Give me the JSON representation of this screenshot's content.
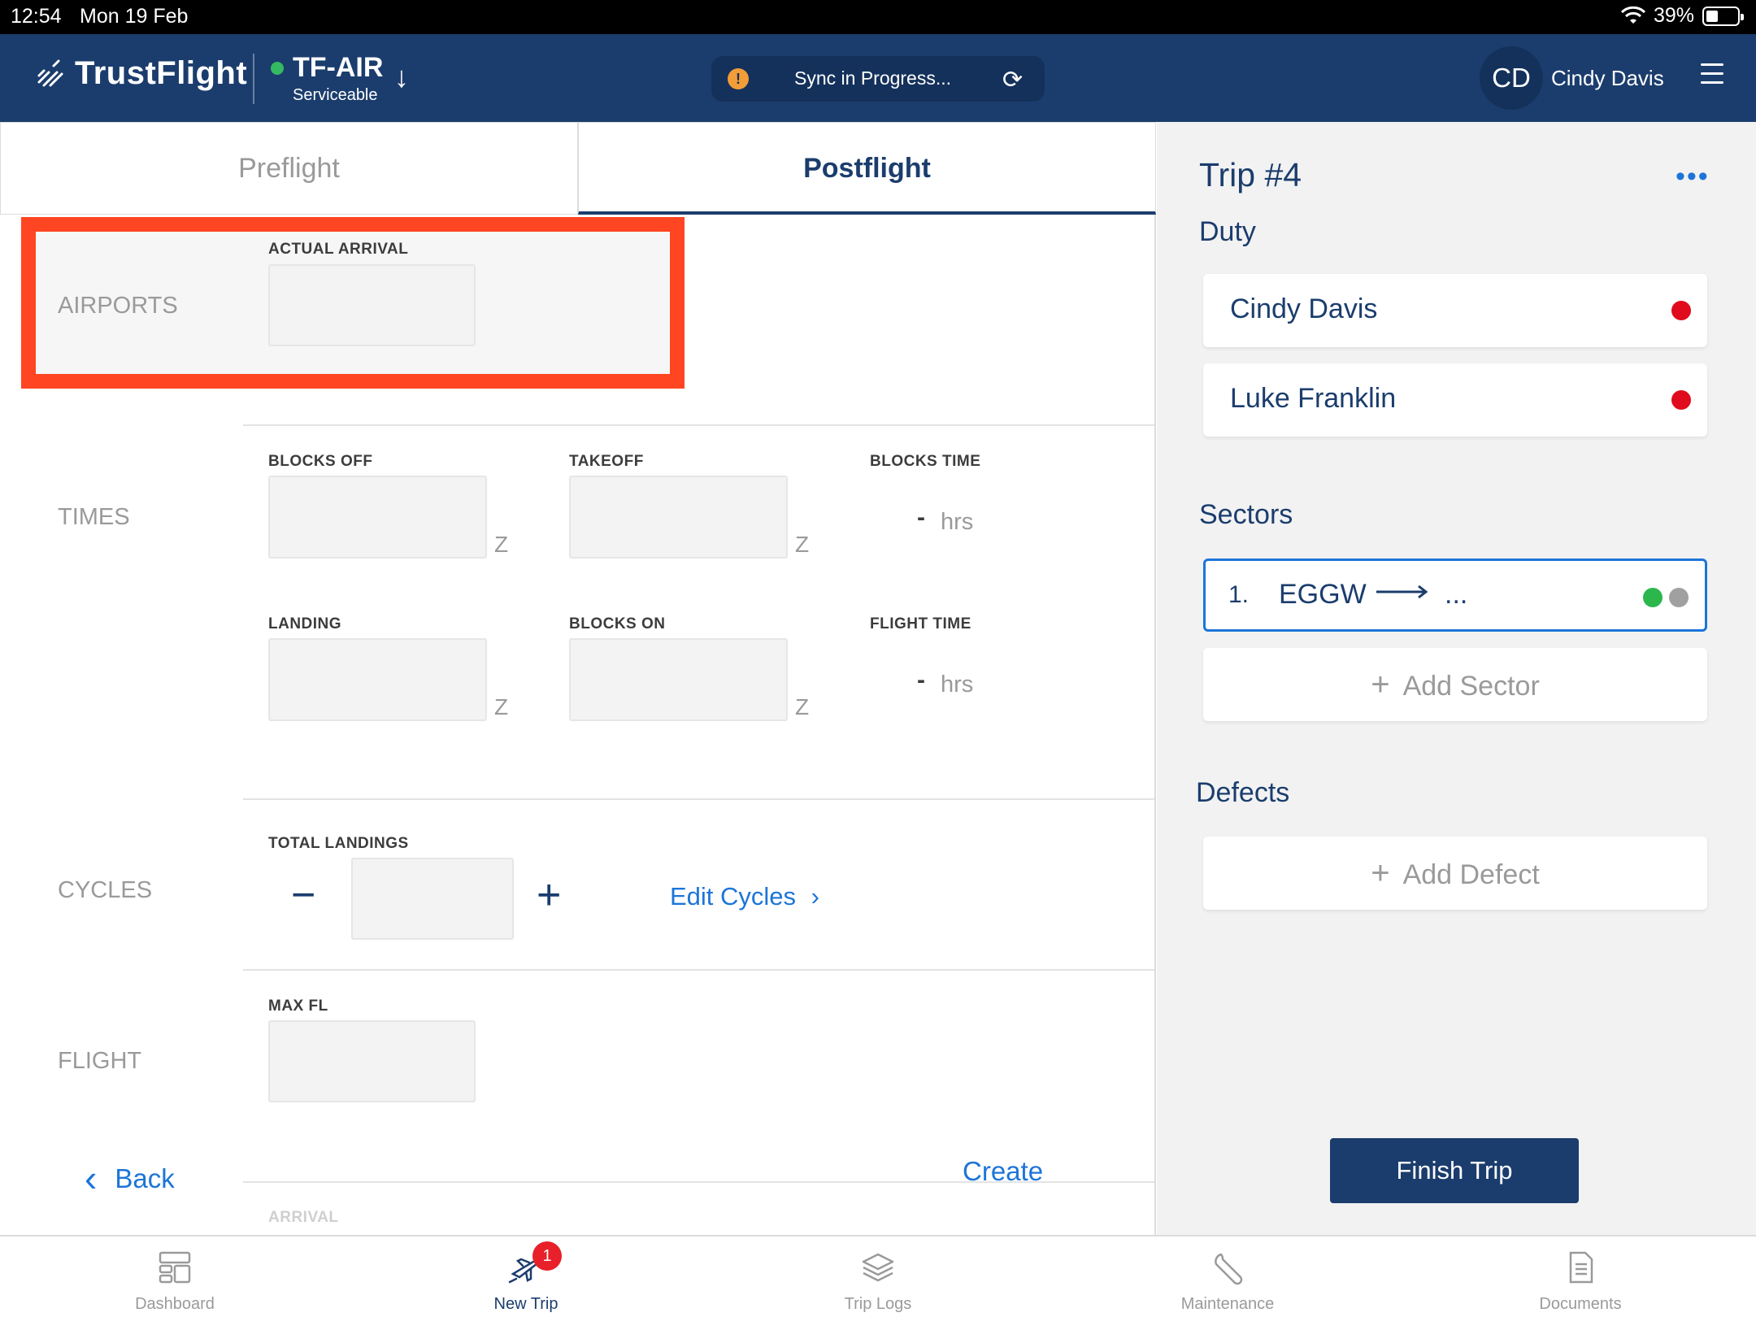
{
  "status_bar": {
    "time": "12:54",
    "date": "Mon 19 Feb",
    "battery": "39%"
  },
  "header": {
    "brand": "TrustFlight",
    "aircraft_reg": "TF-AIR",
    "aircraft_status": "Serviceable",
    "sync_text": "Sync in Progress...",
    "user_initials": "CD",
    "user_name": "Cindy Davis"
  },
  "tabs": [
    {
      "label": "Preflight",
      "active": false
    },
    {
      "label": "Postflight",
      "active": true
    }
  ],
  "form": {
    "airports": {
      "section": "AIRPORTS",
      "actual_arrival_label": "ACTUAL ARRIVAL",
      "actual_arrival_value": ""
    },
    "times": {
      "section": "TIMES",
      "blocks_off_label": "BLOCKS OFF",
      "takeoff_label": "TAKEOFF",
      "blocks_time_label": "BLOCKS TIME",
      "landing_label": "LANDING",
      "blocks_on_label": "BLOCKS ON",
      "flight_time_label": "FLIGHT TIME",
      "zulu": "Z",
      "dash": "-",
      "hrs": "hrs"
    },
    "cycles": {
      "section": "CYCLES",
      "total_landings_label": "TOTAL LANDINGS",
      "total_landings_value": "",
      "edit_cycles": "Edit Cycles"
    },
    "flight": {
      "section": "FLIGHT",
      "max_fl_label": "MAX FL",
      "max_fl_value": ""
    },
    "arrival_label": "ARRIVAL",
    "back": "Back",
    "create": "Create"
  },
  "trip": {
    "title": "Trip #4",
    "duty_heading": "Duty",
    "crew": [
      {
        "name": "Cindy Davis"
      },
      {
        "name": "Luke Franklin"
      }
    ],
    "sectors_heading": "Sectors",
    "sector": {
      "number": "1.",
      "from": "EGGW",
      "to": "..."
    },
    "add_sector": "Add Sector",
    "defects_heading": "Defects",
    "add_defect": "Add Defect",
    "finish_trip": "Finish Trip"
  },
  "tabbar": [
    {
      "label": "Dashboard",
      "icon": "dashboard-icon"
    },
    {
      "label": "New Trip",
      "icon": "plane-icon",
      "badge": "1",
      "active": true
    },
    {
      "label": "Trip Logs",
      "icon": "layers-icon"
    },
    {
      "label": "Maintenance",
      "icon": "wrench-icon"
    },
    {
      "label": "Documents",
      "icon": "document-icon"
    }
  ],
  "colors": {
    "brand": "#1b3d6d",
    "accent": "#1c75d8",
    "highlight": "#ff4522",
    "danger": "#e00b1c",
    "ok": "#2cb74d"
  }
}
